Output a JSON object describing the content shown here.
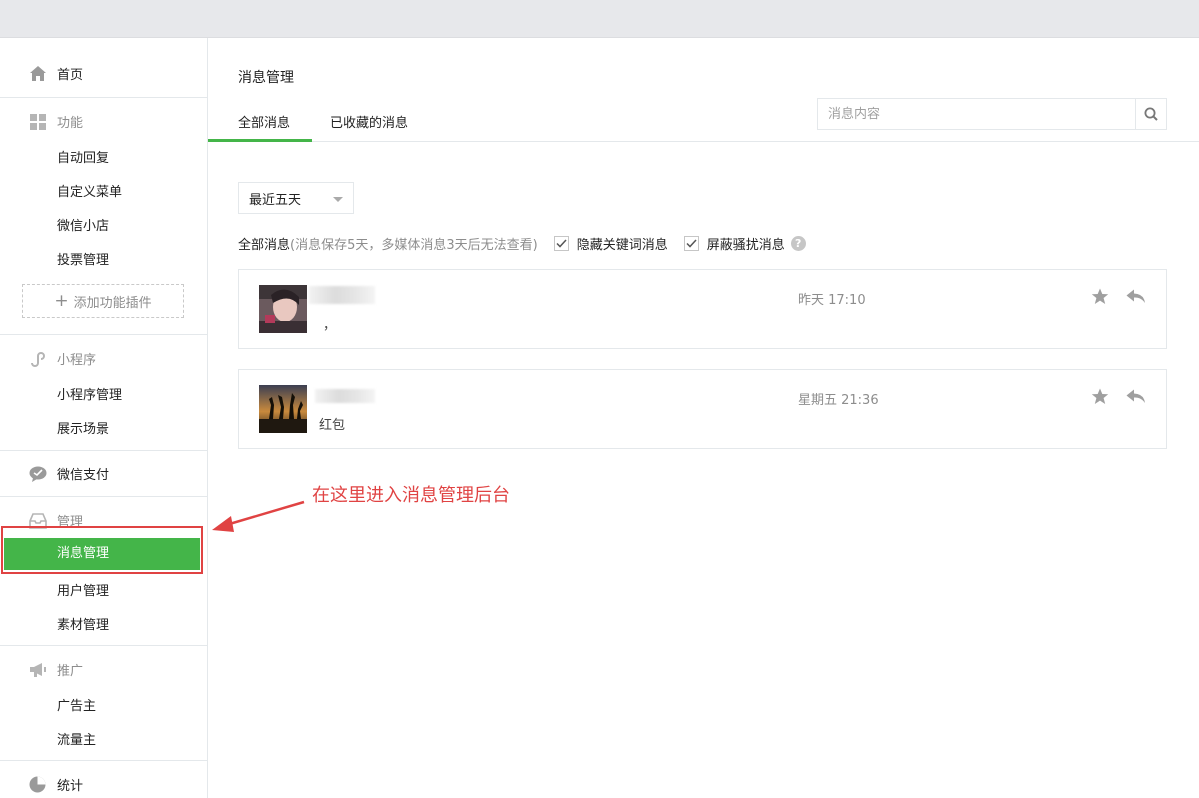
{
  "sidebar": {
    "home": "首页",
    "function": {
      "title": "功能",
      "items": [
        "自动回复",
        "自定义菜单",
        "微信小店",
        "投票管理"
      ],
      "add_plugin": "添加功能插件"
    },
    "miniprogram": {
      "title": "小程序",
      "items": [
        "小程序管理",
        "展示场景"
      ]
    },
    "pay": "微信支付",
    "manage": {
      "title": "管理",
      "items": [
        "消息管理",
        "用户管理",
        "素材管理"
      ],
      "active": "消息管理"
    },
    "promote": {
      "title": "推广",
      "items": [
        "广告主",
        "流量主"
      ]
    },
    "stats": "统计"
  },
  "main": {
    "title": "消息管理",
    "tabs": [
      "全部消息",
      "已收藏的消息"
    ],
    "search_placeholder": "消息内容",
    "dropdown_value": "最近五天",
    "filter": {
      "label": "全部消息",
      "note": "(消息保存5天，多媒体消息3天后无法查看)",
      "hide_keyword": "隐藏关键词消息",
      "block_spam": "屏蔽骚扰消息"
    },
    "messages": [
      {
        "text": "，",
        "time": "昨天 17:10"
      },
      {
        "text": "红包",
        "time": "星期五 21:36"
      }
    ]
  },
  "annotation": "在这里进入消息管理后台",
  "colors": {
    "accent": "#44b549",
    "annotation": "#e04343"
  }
}
